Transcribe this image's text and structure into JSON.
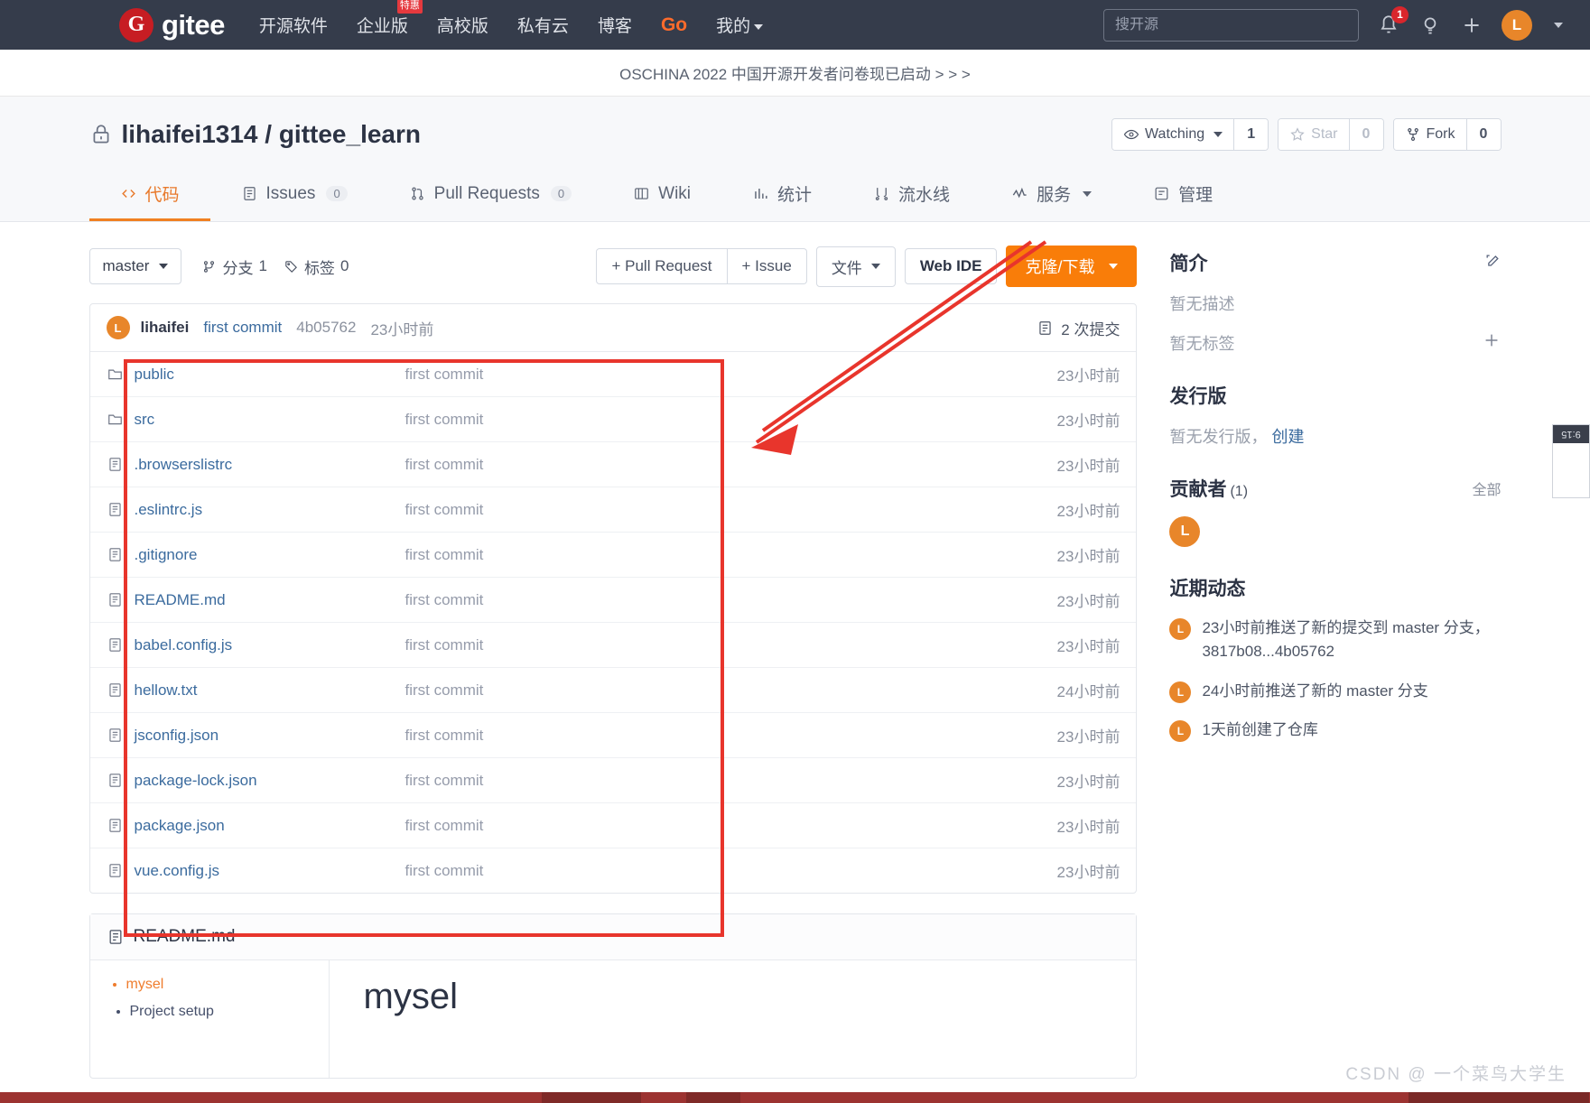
{
  "topnav": {
    "logo_letter": "G",
    "logo_text": "gitee",
    "links": [
      {
        "label": "开源软件",
        "badge": null
      },
      {
        "label": "企业版",
        "badge": "特惠"
      },
      {
        "label": "高校版",
        "badge": null
      },
      {
        "label": "私有云",
        "badge": null
      },
      {
        "label": "博客",
        "badge": null
      },
      {
        "label": "Go",
        "badge": null
      },
      {
        "label": "我的",
        "badge": null
      }
    ],
    "search_placeholder": "搜开源",
    "search_value": "",
    "notification_count": "1",
    "avatar_letter": "L"
  },
  "banner": {
    "text": "OSCHINA 2022 中国开源开发者问卷现已启动 > > >"
  },
  "repo": {
    "owner": "lihaifei1314",
    "separator": "/",
    "name": "gittee_learn",
    "watch_label": "Watching",
    "watch_count": "1",
    "star_label": "Star",
    "star_count": "0",
    "fork_label": "Fork",
    "fork_count": "0"
  },
  "tabs": [
    {
      "label": "代码",
      "count": null,
      "active": true
    },
    {
      "label": "Issues",
      "count": "0",
      "active": false
    },
    {
      "label": "Pull Requests",
      "count": "0",
      "active": false
    },
    {
      "label": "Wiki",
      "count": null,
      "active": false
    },
    {
      "label": "统计",
      "count": null,
      "active": false
    },
    {
      "label": "流水线",
      "count": null,
      "active": false
    },
    {
      "label": "服务",
      "count": null,
      "active": false
    },
    {
      "label": "管理",
      "count": null,
      "active": false
    }
  ],
  "toolbar": {
    "branch": "master",
    "branches_label": "分支",
    "branches_count": "1",
    "tags_label": "标签",
    "tags_count": "0",
    "pull_request_label": "+ Pull Request",
    "issue_label": "+ Issue",
    "files_label": "文件",
    "web_ide_label": "Web IDE",
    "clone_label": "克隆/下载"
  },
  "commit_bar": {
    "avatar_letter": "L",
    "author": "lihaifei",
    "message": "first commit",
    "sha": "4b05762",
    "time": "23小时前",
    "commit_count_label": "2 次提交"
  },
  "files": [
    {
      "name": "public",
      "type": "folder",
      "commit": "first commit",
      "time": "23小时前"
    },
    {
      "name": "src",
      "type": "folder",
      "commit": "first commit",
      "time": "23小时前"
    },
    {
      "name": ".browserslistrc",
      "type": "file",
      "commit": "first commit",
      "time": "23小时前"
    },
    {
      "name": ".eslintrc.js",
      "type": "file",
      "commit": "first commit",
      "time": "23小时前"
    },
    {
      "name": ".gitignore",
      "type": "file",
      "commit": "first commit",
      "time": "23小时前"
    },
    {
      "name": "README.md",
      "type": "file",
      "commit": "first commit",
      "time": "23小时前"
    },
    {
      "name": "babel.config.js",
      "type": "file",
      "commit": "first commit",
      "time": "23小时前"
    },
    {
      "name": "hellow.txt",
      "type": "file",
      "commit": "first commit",
      "time": "24小时前"
    },
    {
      "name": "jsconfig.json",
      "type": "file",
      "commit": "first commit",
      "time": "23小时前"
    },
    {
      "name": "package-lock.json",
      "type": "file",
      "commit": "first commit",
      "time": "23小时前"
    },
    {
      "name": "package.json",
      "type": "file",
      "commit": "first commit",
      "time": "23小时前"
    },
    {
      "name": "vue.config.js",
      "type": "file",
      "commit": "first commit",
      "time": "23小时前"
    }
  ],
  "readme": {
    "title": "README.md",
    "toc": [
      {
        "label": "mysel",
        "level": 1
      },
      {
        "label": "Project setup",
        "level": 2
      }
    ],
    "heading": "mysel"
  },
  "sidebar": {
    "intro": {
      "title": "简介",
      "no_description": "暂无描述",
      "no_tags": "暂无标签"
    },
    "releases": {
      "title": "发行版",
      "none_text": "暂无发行版，",
      "create_link": "创建"
    },
    "contributors": {
      "title": "贡献者",
      "count": "(1)",
      "all_link": "全部",
      "avatar_letter": "L"
    },
    "activity": {
      "title": "近期动态",
      "items": [
        {
          "avatar": "L",
          "text": "23小时前推送了新的提交到 master 分支，3817b08...4b05762"
        },
        {
          "avatar": "L",
          "text": "24小时前推送了新的 master 分支"
        },
        {
          "avatar": "L",
          "text": "1天前创建了仓库"
        }
      ]
    }
  },
  "float_widget": {
    "label": "9:15"
  },
  "watermark": {
    "text": "CSDN @ 一个菜鸟大学生"
  },
  "colors": {
    "brand_red": "#c71d23",
    "accent_orange": "#f97d09",
    "nav_bg": "#353c4b",
    "link_blue": "#3b6b9e",
    "highlight_red": "#e8352c"
  }
}
